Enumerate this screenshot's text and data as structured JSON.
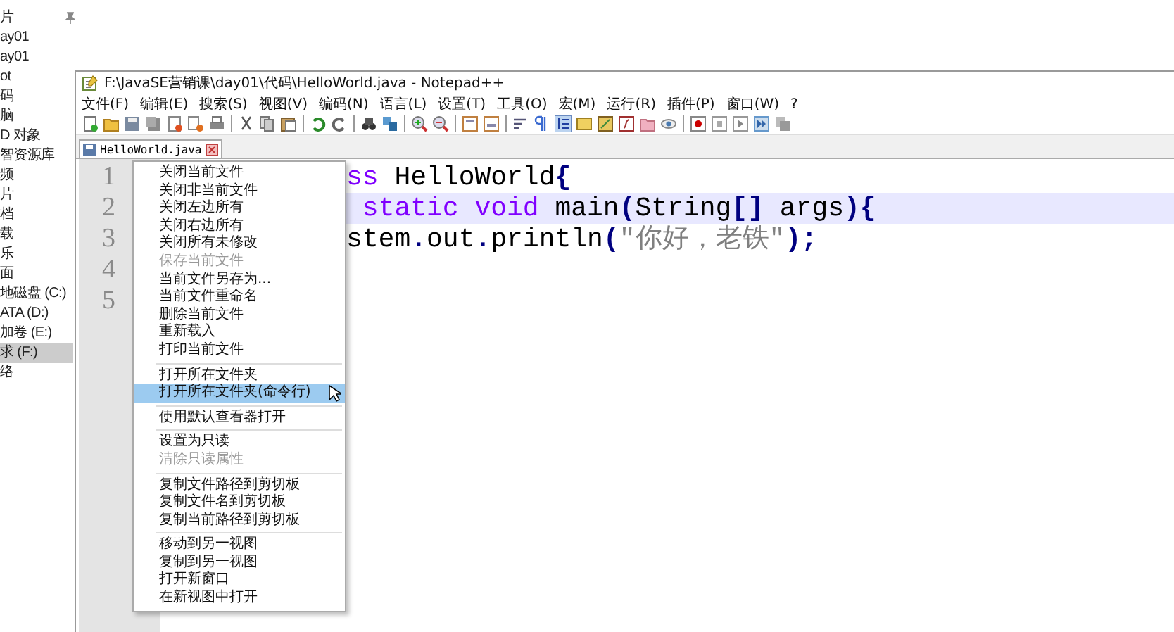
{
  "explorer": {
    "items": [
      {
        "text": "片",
        "pinned": true,
        "selected": false
      },
      {
        "text": "ay01",
        "pinned": false,
        "selected": false
      },
      {
        "text": "ay01",
        "pinned": false,
        "selected": false
      },
      {
        "text": "ot",
        "pinned": false,
        "selected": false
      },
      {
        "text": "码",
        "pinned": false,
        "selected": false
      },
      {
        "text": "脑",
        "pinned": false,
        "selected": false
      },
      {
        "text": "D 对象",
        "pinned": false,
        "selected": false
      },
      {
        "text": "智资源库",
        "pinned": false,
        "selected": false
      },
      {
        "text": "频",
        "pinned": false,
        "selected": false
      },
      {
        "text": "片",
        "pinned": false,
        "selected": false
      },
      {
        "text": "档",
        "pinned": false,
        "selected": false
      },
      {
        "text": "载",
        "pinned": false,
        "selected": false
      },
      {
        "text": "乐",
        "pinned": false,
        "selected": false
      },
      {
        "text": "面",
        "pinned": false,
        "selected": false
      },
      {
        "text": "地磁盘 (C:)",
        "pinned": false,
        "selected": false
      },
      {
        "text": "ATA (D:)",
        "pinned": false,
        "selected": false
      },
      {
        "text": "加卷 (E:)",
        "pinned": false,
        "selected": false
      },
      {
        "text": "求 (F:)",
        "pinned": false,
        "selected": true
      },
      {
        "text": "络",
        "pinned": false,
        "selected": false
      }
    ]
  },
  "window": {
    "title": "F:\\JavaSE营销课\\day01\\代码\\HelloWorld.java - Notepad++",
    "menu": [
      "文件(F)",
      "编辑(E)",
      "搜索(S)",
      "视图(V)",
      "编码(N)",
      "语言(L)",
      "设置(T)",
      "工具(O)",
      "宏(M)",
      "运行(R)",
      "插件(P)",
      "窗口(W)",
      "?"
    ],
    "tabs": [
      {
        "label": "HelloWorld.java",
        "selected": true
      }
    ],
    "editor": {
      "line_numbers": [
        "1",
        "2",
        "3",
        "4",
        "5"
      ],
      "lines": [
        {
          "current": false,
          "tokens": [
            {
              "text": "ss",
              "kind": "keyword"
            },
            {
              "text": " HelloWorld",
              "kind": "plain"
            },
            {
              "text": "{",
              "kind": "operator"
            }
          ]
        },
        {
          "current": true,
          "tokens": [
            {
              "text": " static void",
              "kind": "keyword"
            },
            {
              "text": " main",
              "kind": "plain"
            },
            {
              "text": "(",
              "kind": "operator"
            },
            {
              "text": "String",
              "kind": "plain"
            },
            {
              "text": "[]",
              "kind": "operator"
            },
            {
              "text": " args",
              "kind": "plain"
            },
            {
              "text": "){",
              "kind": "operator"
            }
          ]
        },
        {
          "current": false,
          "tokens": [
            {
              "text": "stem",
              "kind": "plain"
            },
            {
              "text": ".",
              "kind": "operator"
            },
            {
              "text": "out",
              "kind": "plain"
            },
            {
              "text": ".",
              "kind": "operator"
            },
            {
              "text": "println",
              "kind": "plain"
            },
            {
              "text": "(",
              "kind": "operator"
            },
            {
              "text": "\"你好，老铁\"",
              "kind": "string"
            },
            {
              "text": ");",
              "kind": "operator"
            }
          ]
        }
      ]
    },
    "context_menu": {
      "groups": [
        [
          {
            "label": "关闭当前文件",
            "disabled": false,
            "selected": false
          },
          {
            "label": "关闭非当前文件",
            "disabled": false,
            "selected": false
          },
          {
            "label": "关闭左边所有",
            "disabled": false,
            "selected": false
          },
          {
            "label": "关闭右边所有",
            "disabled": false,
            "selected": false
          },
          {
            "label": "关闭所有未修改",
            "disabled": false,
            "selected": false
          },
          {
            "label": "保存当前文件",
            "disabled": true,
            "selected": false
          },
          {
            "label": "当前文件另存为...",
            "disabled": false,
            "selected": false
          },
          {
            "label": "当前文件重命名",
            "disabled": false,
            "selected": false
          },
          {
            "label": "删除当前文件",
            "disabled": false,
            "selected": false
          },
          {
            "label": "重新载入",
            "disabled": false,
            "selected": false
          },
          {
            "label": "打印当前文件",
            "disabled": false,
            "selected": false
          }
        ],
        [
          {
            "label": "打开所在文件夹",
            "disabled": false,
            "selected": false
          },
          {
            "label": "打开所在文件夹(命令行)",
            "disabled": false,
            "selected": true
          }
        ],
        [
          {
            "label": "使用默认查看器打开",
            "disabled": false,
            "selected": false
          }
        ],
        [
          {
            "label": "设置为只读",
            "disabled": false,
            "selected": false
          },
          {
            "label": "清除只读属性",
            "disabled": true,
            "selected": false
          }
        ],
        [
          {
            "label": "复制文件路径到剪切板",
            "disabled": false,
            "selected": false
          },
          {
            "label": "复制文件名到剪切板",
            "disabled": false,
            "selected": false
          },
          {
            "label": "复制当前路径到剪切板",
            "disabled": false,
            "selected": false
          }
        ],
        [
          {
            "label": "移动到另一视图",
            "disabled": false,
            "selected": false
          },
          {
            "label": "复制到另一视图",
            "disabled": false,
            "selected": false
          },
          {
            "label": "打开新窗口",
            "disabled": false,
            "selected": false
          },
          {
            "label": "在新视图中打开",
            "disabled": false,
            "selected": false
          }
        ]
      ]
    }
  }
}
